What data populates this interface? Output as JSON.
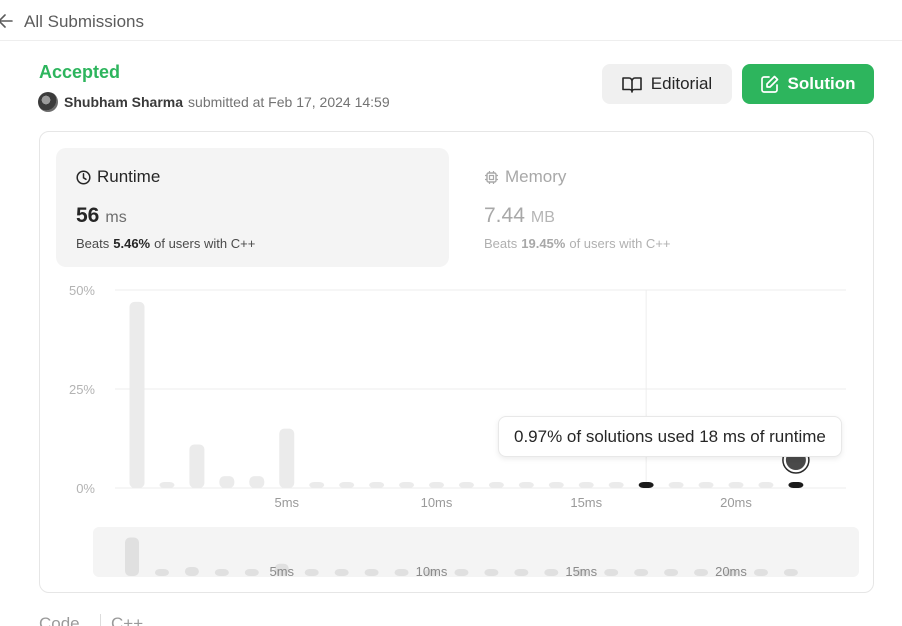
{
  "topbar": {
    "back_label": "All Submissions"
  },
  "submission": {
    "status": "Accepted",
    "author": "Shubham Sharma",
    "submitted_text": "submitted at Feb 17, 2024 14:59"
  },
  "buttons": {
    "editorial": "Editorial",
    "solution": "Solution"
  },
  "runtime": {
    "title": "Runtime",
    "value": "56",
    "unit": "ms",
    "beats_prefix": "Beats",
    "beats_pct": "5.46%",
    "beats_suffix": "of users with C++"
  },
  "memory": {
    "title": "Memory",
    "value": "7.44",
    "unit": "MB",
    "beats_prefix": "Beats",
    "beats_pct": "19.45%",
    "beats_suffix": "of users with C++"
  },
  "tooltip": "0.97% of solutions used 18 ms of runtime",
  "code": {
    "label": "Code",
    "lang": "C++"
  },
  "colors": {
    "accent": "#2db55d",
    "bar": "#ebebeb",
    "highlight": "#1a1a1a"
  },
  "chart_data": {
    "type": "bar",
    "x": [
      1,
      2,
      3,
      4,
      5,
      6,
      7,
      8,
      9,
      10,
      11,
      12,
      13,
      14,
      15,
      16,
      17,
      18,
      19,
      20,
      21,
      22,
      23
    ],
    "values": [
      47,
      1,
      11,
      3,
      3,
      15,
      1,
      1,
      1,
      1,
      1,
      1,
      1,
      1,
      1,
      1,
      1,
      0.97,
      1,
      1,
      1,
      1,
      1
    ],
    "highlight_x": [
      18,
      23
    ],
    "y_ticks": [
      "50%",
      "25%",
      "0%"
    ],
    "ylim": [
      0,
      50
    ],
    "x_ticks": [
      {
        "x": 6,
        "label": "5ms"
      },
      {
        "x": 11,
        "label": "10ms"
      },
      {
        "x": 16,
        "label": "15ms"
      },
      {
        "x": 21,
        "label": "20ms"
      }
    ],
    "grid": true
  }
}
